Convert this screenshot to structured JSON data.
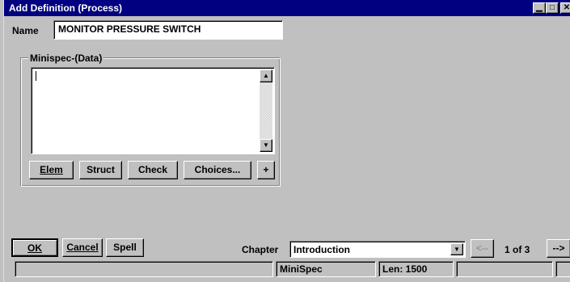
{
  "window": {
    "title": "Add  Definition (Process)",
    "minimize_glyph": "▁",
    "maximize_glyph": "□",
    "close_glyph": "✕"
  },
  "name": {
    "label": "Name",
    "value": "MONITOR PRESSURE SWITCH"
  },
  "minispec": {
    "group_label": "Minispec-(Data)",
    "text": "",
    "scroll_up_glyph": "▲",
    "scroll_down_glyph": "▼"
  },
  "minispec_buttons": {
    "elem": "Elem",
    "struct": "Struct",
    "check": "Check",
    "choices": "Choices...",
    "plus": "+"
  },
  "footer": {
    "ok": "OK",
    "cancel": "Cancel",
    "spell": "Spell",
    "chapter_label": "Chapter",
    "chapter_value": "Introduction",
    "dropdown_glyph": "▼",
    "prev": "<--",
    "page": "1 of 3",
    "next": "-->"
  },
  "status": {
    "mode": "MiniSpec",
    "length": "Len: 1500"
  },
  "colors": {
    "titlebar": "#000080",
    "face": "#c0c0c0",
    "field": "#ffffff"
  }
}
